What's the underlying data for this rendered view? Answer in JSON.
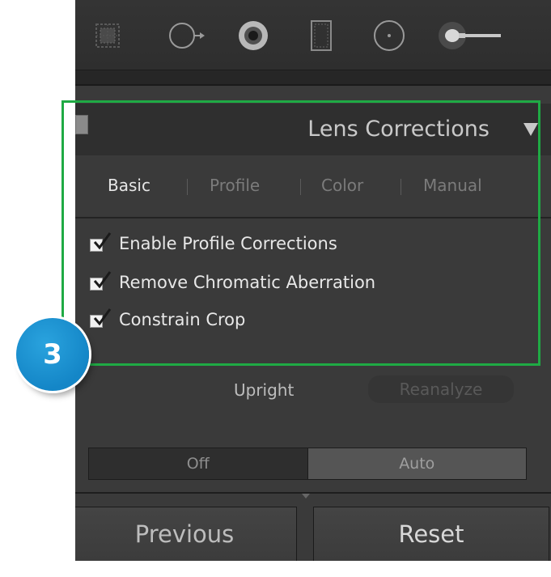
{
  "toolbar": {
    "tools": [
      {
        "icon": "crop-overlay-icon"
      },
      {
        "icon": "spot-removal-icon"
      },
      {
        "icon": "red-eye-icon"
      },
      {
        "icon": "graduated-filter-icon"
      },
      {
        "icon": "radial-filter-icon"
      },
      {
        "icon": "adjustment-brush-icon"
      }
    ]
  },
  "lens_panel": {
    "title": "Lens Corrections",
    "tabs": [
      {
        "label": "Basic",
        "active": true
      },
      {
        "label": "Profile",
        "active": false
      },
      {
        "label": "Color",
        "active": false
      },
      {
        "label": "Manual",
        "active": false
      }
    ],
    "options": [
      {
        "label": "Enable Profile Corrections",
        "checked": true
      },
      {
        "label": "Remove Chromatic Aberration",
        "checked": true
      },
      {
        "label": "Constrain Crop",
        "checked": true
      }
    ]
  },
  "upright": {
    "label": "Upright",
    "reanalyze_label": "Reanalyze",
    "modes": [
      {
        "label": "Off"
      },
      {
        "label": "Auto"
      }
    ]
  },
  "footer": {
    "previous_label": "Previous",
    "reset_label": "Reset"
  },
  "annotation": {
    "step_number": "3",
    "highlight_color": "#1faa44",
    "badge_color": "#1a8fd0"
  }
}
